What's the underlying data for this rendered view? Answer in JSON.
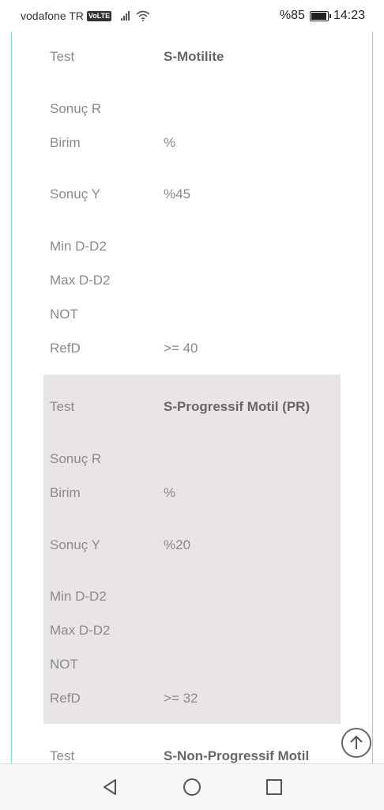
{
  "status_bar": {
    "carrier": "vodafone TR",
    "volte": "VoLTE",
    "battery_text": "%85",
    "time": "14:23",
    "icons": [
      "signal-icon",
      "wifi-icon",
      "battery-icon"
    ]
  },
  "tests": [
    {
      "test_label": "Test",
      "test_value": "S-Motilite",
      "sonuc_r_label": "Sonuç R",
      "sonuc_r_value": "",
      "birim_label": "Birim",
      "birim_value": "%",
      "sonuc_y_label": "Sonuç Y",
      "sonuc_y_value": "%45",
      "min_label": "Min D-D2",
      "min_value": "",
      "max_label": "Max D-D2",
      "max_value": "",
      "not_label": "NOT",
      "not_value": "",
      "refd_label": "RefD",
      "refd_value": ">= 40"
    },
    {
      "test_label": "Test",
      "test_value": "S-Progressif Motil (PR)",
      "sonuc_r_label": "Sonuç R",
      "sonuc_r_value": "",
      "birim_label": "Birim",
      "birim_value": "%",
      "sonuc_y_label": "Sonuç Y",
      "sonuc_y_value": "%20",
      "min_label": "Min D-D2",
      "min_value": "",
      "max_label": "Max D-D2",
      "max_value": "",
      "not_label": "NOT",
      "not_value": "",
      "refd_label": "RefD",
      "refd_value": ">= 32"
    },
    {
      "test_label": "Test",
      "test_value": "S-Non-Progressif Motil"
    }
  ],
  "scroll_top_icon": "arrow-up-icon",
  "nav_bar": {
    "icons": [
      "back-icon",
      "home-icon",
      "recents-icon"
    ]
  },
  "colors": {
    "shaded_row_bg": "#e9e5e4",
    "frame_border": "#8fd6cf",
    "label_text": "#8a8a8a"
  }
}
